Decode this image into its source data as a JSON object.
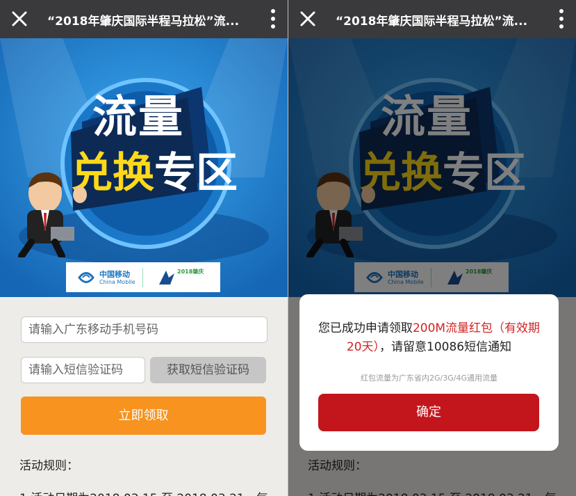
{
  "left": {
    "title": "“2018年肇庆国际半程马拉松”流...",
    "banner": {
      "headline_line1": "流量",
      "headline_line2_yellow": "兑换",
      "headline_line2_white": "专区",
      "china_mobile_cn": "中国移动",
      "china_mobile_en": "China Mobile",
      "year_badge": "2018肇庆"
    },
    "phone_placeholder": "请输入广东移动手机号码",
    "sms_placeholder": "请输入短信验证码",
    "sms_button": "获取短信验证码",
    "submit_button": "立即领取",
    "rules_title": "活动规则：",
    "rules_line1": "1.活动日期为2018.03.15 至 2018.03.21，每"
  },
  "right": {
    "title": "“2018年肇庆国际半程马拉松”流...",
    "dialog": {
      "msg_prefix": "您已成功申请领取",
      "msg_highlight": "200M流量红包（有效期20天）",
      "msg_suffix": "，请留意10086短信通知",
      "note": "红包流量为广东省内2G/3G/4G通用流量",
      "confirm": "确定"
    },
    "rules_title": "活动规则：",
    "rules_line1": "1.活动日期为2018.03.15 至 2018.03.21，每"
  },
  "colors": {
    "topbar": "#3a3a3c",
    "banner_blue": "#1f86d4",
    "accent_orange": "#f7931e",
    "confirm_red": "#c3161c",
    "highlight_red": "#d42323"
  },
  "icons": [
    "close-icon",
    "more-vertical-icon",
    "china-mobile-logo-icon",
    "marathon-logo-icon"
  ]
}
